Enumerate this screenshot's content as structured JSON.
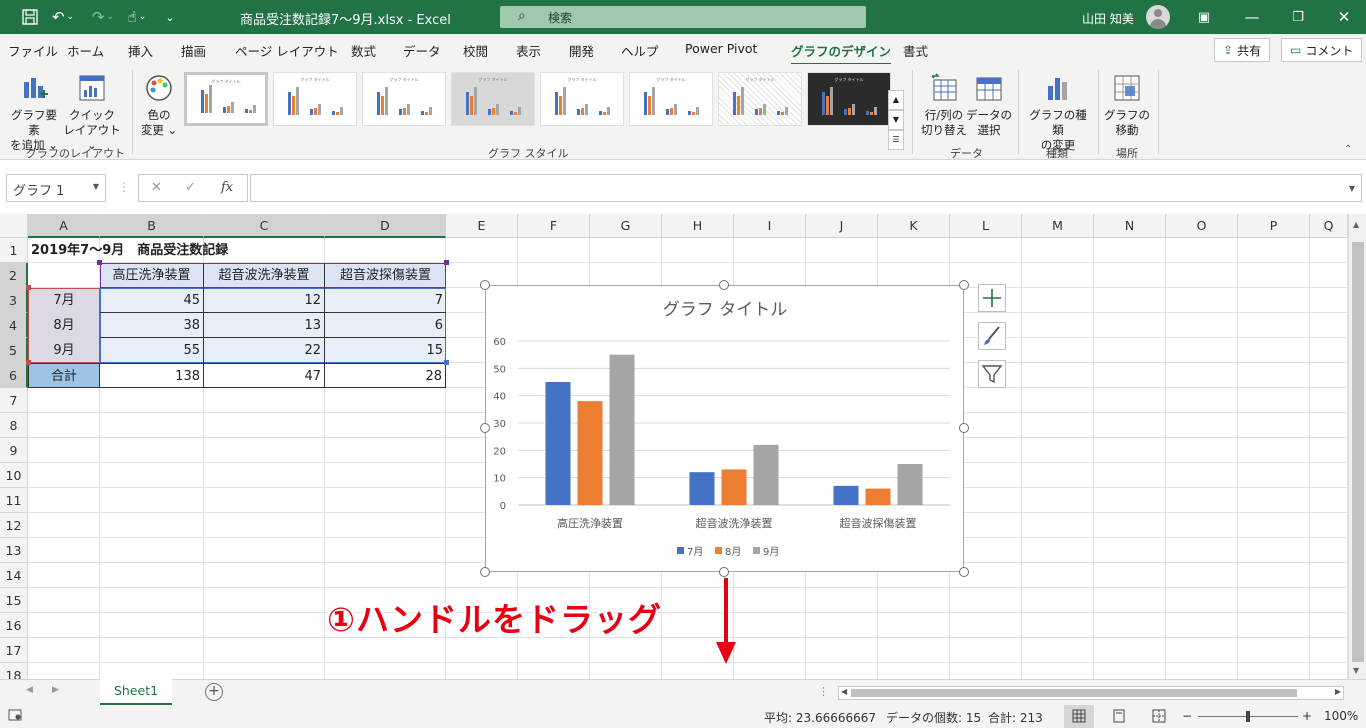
{
  "titlebar": {
    "title": "商品受注数記録7～9月.xlsx  -  Excel",
    "search_label": "検索",
    "user_name": "山田 知美"
  },
  "tabs": [
    {
      "label": "ファイル"
    },
    {
      "label": "ホーム"
    },
    {
      "label": "挿入"
    },
    {
      "label": "描画"
    },
    {
      "label": "ページ レイアウト"
    },
    {
      "label": "数式"
    },
    {
      "label": "データ"
    },
    {
      "label": "校閲"
    },
    {
      "label": "表示"
    },
    {
      "label": "開発"
    },
    {
      "label": "ヘルプ"
    },
    {
      "label": "Power Pivot"
    },
    {
      "label": "グラフのデザイン"
    },
    {
      "label": "書式"
    }
  ],
  "share_label": "共有",
  "comment_label": "コメント",
  "ribbon": {
    "add_element": [
      "グラフ要素",
      "を追加 ⌄"
    ],
    "quick_layout": [
      "クイック",
      "レイアウト ⌄"
    ],
    "group_layout": "グラフのレイアウト",
    "change_color": [
      "色の",
      "変更 ⌄"
    ],
    "group_styles": "グラフ スタイル",
    "switch_rowcol": [
      "行/列の",
      "切り替え"
    ],
    "select_data": [
      "データの",
      "選択"
    ],
    "group_data": "データ",
    "change_type": [
      "グラフの種類",
      "の変更"
    ],
    "group_type": "種類",
    "move_chart": [
      "グラフの",
      "移動"
    ],
    "group_location": "場所",
    "thumb_title": "グラフ タイトル"
  },
  "formula": {
    "namebox": "グラフ 1",
    "fx": "fx",
    "value": ""
  },
  "columns": [
    "A",
    "B",
    "C",
    "D",
    "E",
    "F",
    "G",
    "H",
    "I",
    "J",
    "K",
    "L",
    "M",
    "N",
    "O",
    "P",
    "Q"
  ],
  "rows": [
    "1",
    "2",
    "3",
    "4",
    "5",
    "6",
    "7",
    "8",
    "9",
    "10",
    "11",
    "12",
    "13",
    "14",
    "15",
    "16",
    "17",
    "18"
  ],
  "table": {
    "title": "2019年7～9月　商品受注数記録",
    "headers": [
      "高圧洗浄装置",
      "超音波洗浄装置",
      "超音波探傷装置"
    ],
    "rows": [
      {
        "label": "7月",
        "values": [
          "45",
          "12",
          "7"
        ]
      },
      {
        "label": "8月",
        "values": [
          "38",
          "13",
          "6"
        ]
      },
      {
        "label": "9月",
        "values": [
          "55",
          "22",
          "15"
        ]
      }
    ],
    "total": {
      "label": "合計",
      "values": [
        "138",
        "47",
        "28"
      ]
    }
  },
  "chart_data": {
    "type": "bar",
    "title": "グラフ タイトル",
    "categories": [
      "高圧洗浄装置",
      "超音波洗浄装置",
      "超音波探傷装置"
    ],
    "series": [
      {
        "name": "7月",
        "values": [
          45,
          12,
          7
        ],
        "color": "#4472c4"
      },
      {
        "name": "8月",
        "values": [
          38,
          13,
          6
        ],
        "color": "#ed7d31"
      },
      {
        "name": "9月",
        "values": [
          55,
          22,
          15
        ],
        "color": "#a5a5a5"
      }
    ],
    "ylim": [
      0,
      60
    ],
    "yticks": [
      0,
      10,
      20,
      30,
      40,
      50,
      60
    ],
    "grid": true,
    "legend": "bottom"
  },
  "annotation": "①ハンドルをドラッグ",
  "sheet_tab": "Sheet1",
  "status": {
    "average": "平均: 23.66666667",
    "count": "データの個数: 15",
    "sum": "合計: 213",
    "zoom": "100%"
  }
}
